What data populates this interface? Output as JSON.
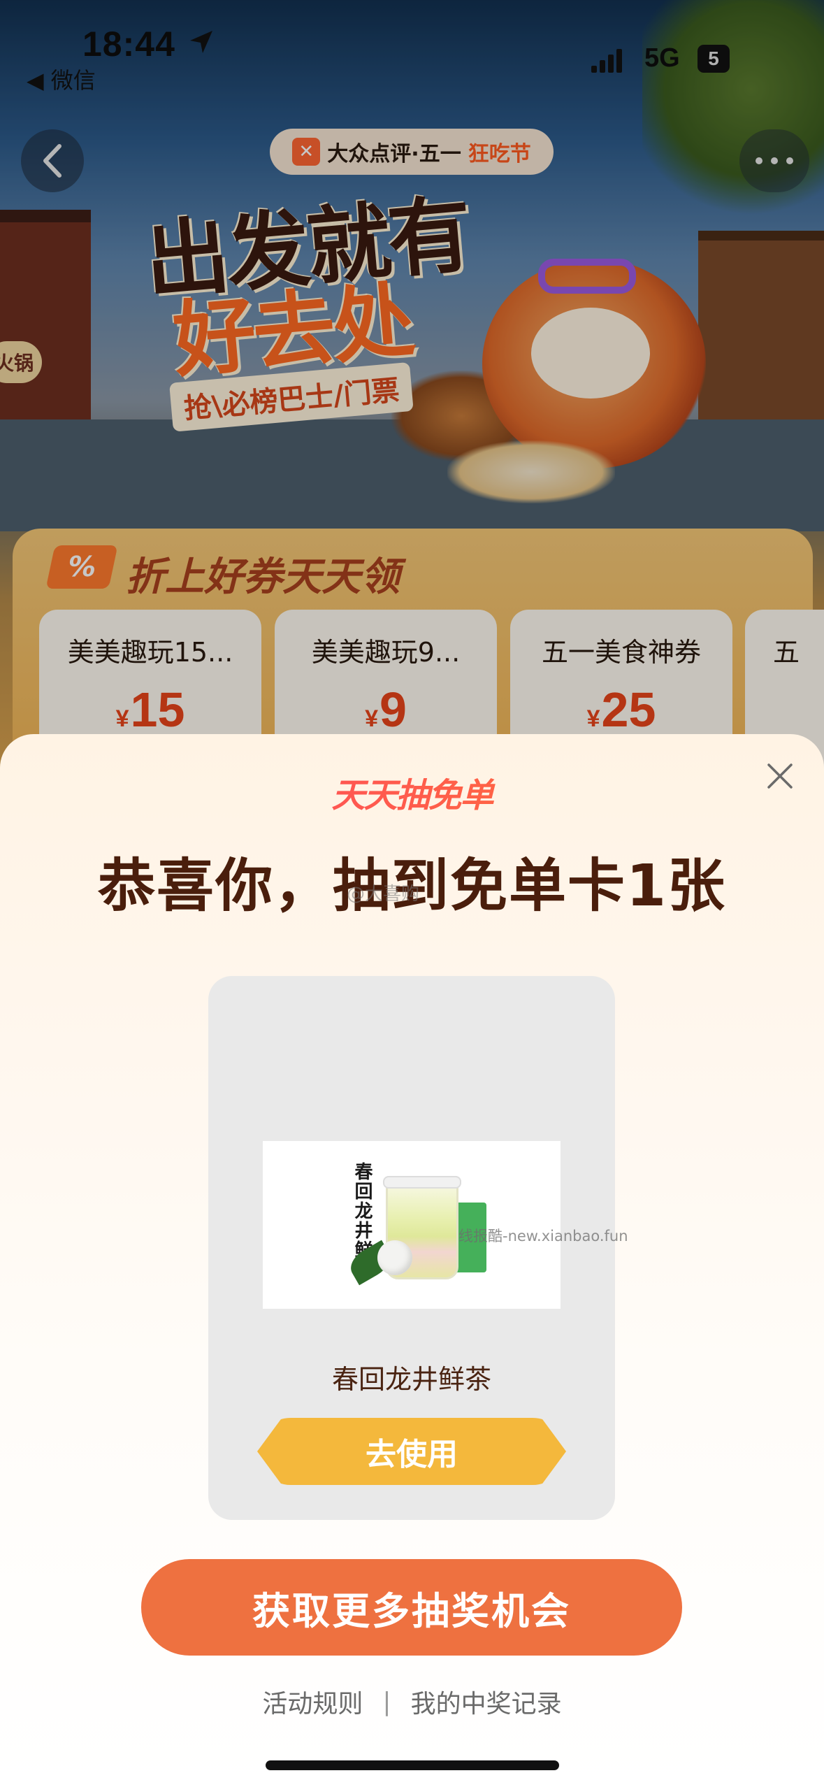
{
  "status_bar": {
    "time": "18:44",
    "back_app": "◀ 微信",
    "network": "5G",
    "battery": "5"
  },
  "header": {
    "brand_name": "大众点评·五一",
    "brand_accent": "狂吃节"
  },
  "hero": {
    "line1": "出发就有",
    "line2": "好去处",
    "subtitle": "抢\\必榜巴士/门票",
    "shop_sign": "火锅"
  },
  "coupons": {
    "tag": "%",
    "heading": "折上好券天天领",
    "items": [
      {
        "title": "美美趣玩15...",
        "currency": "¥",
        "value": "15"
      },
      {
        "title": "美美趣玩9...",
        "currency": "¥",
        "value": "9"
      },
      {
        "title": "五一美食神券",
        "currency": "¥",
        "value": "25"
      },
      {
        "title": "五",
        "currency": "",
        "value": ""
      }
    ]
  },
  "sheet": {
    "brand": "天天抽免单",
    "title": "恭喜你，抽到免单卡1张",
    "watermark_top": "@大喜购",
    "prize": {
      "image_text": "春回龙井鲜茶",
      "watermark_mid": "线报酷-new.xianbao.fun",
      "name": "春回龙井鲜茶",
      "use_button": "去使用"
    },
    "more_button": "获取更多抽奖机会",
    "rules_link": "活动规则",
    "separator": "|",
    "records_link": "我的中奖记录"
  },
  "colors": {
    "primary_orange": "#ee7140",
    "use_button_yellow": "#f4b83c",
    "title_brown": "#4a1e0c"
  },
  "icons": [
    "location-arrow-icon",
    "signal-icon",
    "back-chevron-icon",
    "more-dots-icon",
    "close-icon"
  ]
}
